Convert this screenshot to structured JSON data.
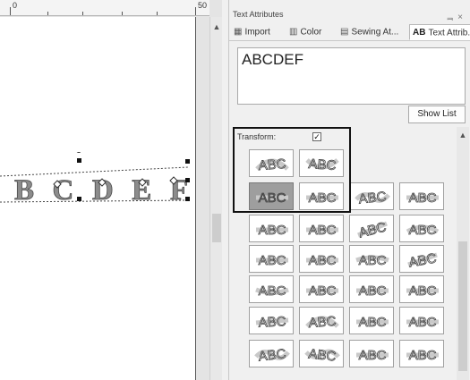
{
  "ruler": {
    "labels": [
      "0",
      "50"
    ]
  },
  "canvas": {
    "text": "BCDEF"
  },
  "panel": {
    "title": "Text Attributes",
    "window_buttons": "ၤ ×",
    "tabs": [
      {
        "label": "Import",
        "icon": "import-icon"
      },
      {
        "label": "Color",
        "icon": "color-icon"
      },
      {
        "label": "Sewing At...",
        "icon": "sewing-icon"
      },
      {
        "label": "Text Attrib...",
        "icon": "text-attributes-icon",
        "prefix": "AB"
      }
    ],
    "text_value": "ABCDEF",
    "show_list_label": "Show List",
    "transform_label": "Transform:",
    "transform_checked": true,
    "shape_label": "ABC",
    "shapes": [
      "arch-up",
      "arch-down",
      "normal",
      "normal",
      "wave",
      "normal",
      "normal",
      "normal",
      "slant",
      "arch-low",
      "normal",
      "normal",
      "bulge-out",
      "slant-bold",
      "bulge",
      "normal",
      "normal",
      "normal",
      "taper",
      "arch-up",
      "normal",
      "normal",
      "wave",
      "wave-inv",
      "normal",
      "normal"
    ]
  }
}
